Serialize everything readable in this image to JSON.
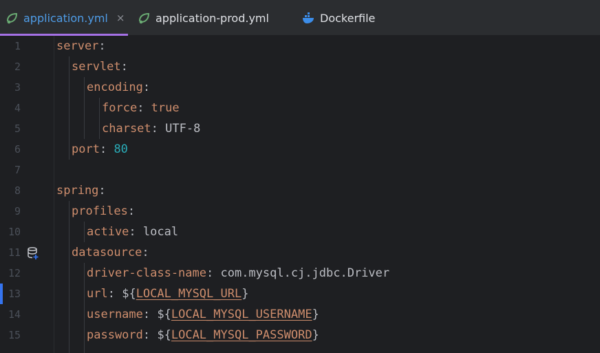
{
  "tabs": [
    {
      "label": "application.yml",
      "active": true,
      "close": "×",
      "icon": "spring-leaf-icon"
    },
    {
      "label": "application-prod.yml",
      "active": false,
      "icon": "spring-leaf-icon"
    },
    {
      "label": "Dockerfile",
      "active": false,
      "icon": "docker-whale-icon"
    }
  ],
  "colors": {
    "key": "#cf8e6d",
    "number": "#2aacb8",
    "accent": "#a571e6",
    "active_tab": "#4f9de8"
  },
  "lines": [
    {
      "n": "1",
      "key": "server",
      "sep": ":",
      "value": ""
    },
    {
      "n": "2",
      "key": "servlet",
      "sep": ":",
      "value": ""
    },
    {
      "n": "3",
      "key": "encoding",
      "sep": ":",
      "value": ""
    },
    {
      "n": "4",
      "key": "force",
      "sep": ": ",
      "value": "true"
    },
    {
      "n": "5",
      "key": "charset",
      "sep": ": ",
      "value": "UTF-8"
    },
    {
      "n": "6",
      "key": "port",
      "sep": ": ",
      "value": "80"
    },
    {
      "n": "7"
    },
    {
      "n": "8",
      "key": "spring",
      "sep": ":",
      "value": ""
    },
    {
      "n": "9",
      "key": "profiles",
      "sep": ":",
      "value": ""
    },
    {
      "n": "10",
      "key": "active",
      "sep": ": ",
      "value": "local"
    },
    {
      "n": "11",
      "key": "datasource",
      "sep": ":",
      "value": "",
      "gutter_icon": "database-icon"
    },
    {
      "n": "12",
      "key": "driver-class-name",
      "sep": ": ",
      "value": "com.mysql.cj.jdbc.Driver"
    },
    {
      "n": "13",
      "key": "url",
      "sep": ": ",
      "pre": "${",
      "var": "LOCAL_MYSQL_URL",
      "post": "}",
      "modified": true
    },
    {
      "n": "14",
      "key": "username",
      "sep": ": ",
      "pre": "${",
      "var": "LOCAL_MYSQL_USERNAME",
      "post": "}"
    },
    {
      "n": "15",
      "key": "password",
      "sep": ": ",
      "pre": "${",
      "var": "LOCAL_MYSQL_PASSWORD",
      "post": "}"
    }
  ]
}
